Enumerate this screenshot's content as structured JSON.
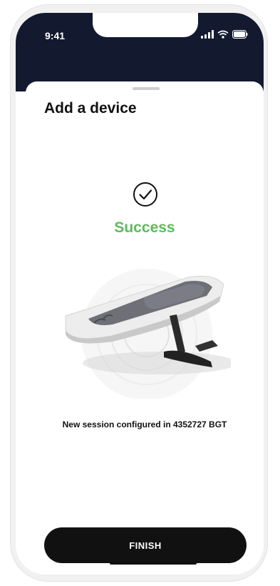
{
  "status_bar": {
    "time": "9:41",
    "icons": [
      "signal-icon",
      "wifi-icon",
      "battery-icon"
    ]
  },
  "sheet": {
    "title": "Add a device",
    "status_icon": "check-circle-icon",
    "status_text": "Success",
    "status_color": "#5cbc5b",
    "message": "New session configured in 4352727 BGT",
    "finish_label": "FINISH"
  },
  "colors": {
    "header_background": "#131a2f",
    "button_background": "#111111",
    "text_primary": "#111111"
  }
}
